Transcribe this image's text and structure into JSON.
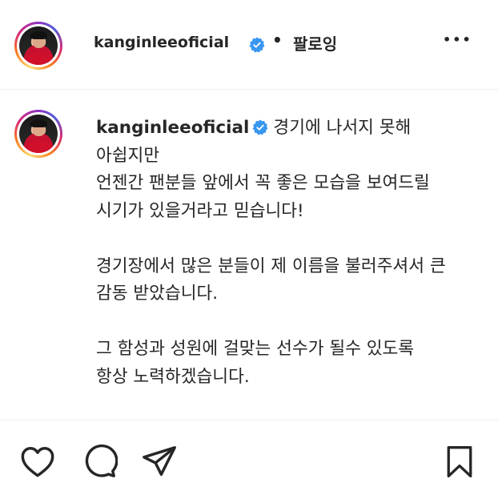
{
  "header": {
    "username": "kanginleeoficial",
    "separator": "•",
    "follow_status": "팔로잉",
    "more_label": "•••"
  },
  "caption": {
    "username": "kanginleeoficial",
    "text": "경기에 나서지 못해 아쉽지만\n언젠간 팬분들 앞에서 꼭 좋은 모습을 보여드릴 시기가 있을거라고 믿습니다!\n\n경기장에서 많은 분들이 제 이름을 불러주셔서 큰 감동 받았습니다.\n\n그 함성과 성원에 걸맞는 선수가 될수 있도록 항상 노력하겠습니다."
  },
  "icons": {
    "verified": "verified-badge-icon",
    "like": "heart-icon",
    "comment": "comment-icon",
    "share": "paper-plane-icon",
    "save": "bookmark-icon"
  },
  "colors": {
    "verified": "#3897f0",
    "text": "#262626",
    "divider": "#efefef"
  }
}
